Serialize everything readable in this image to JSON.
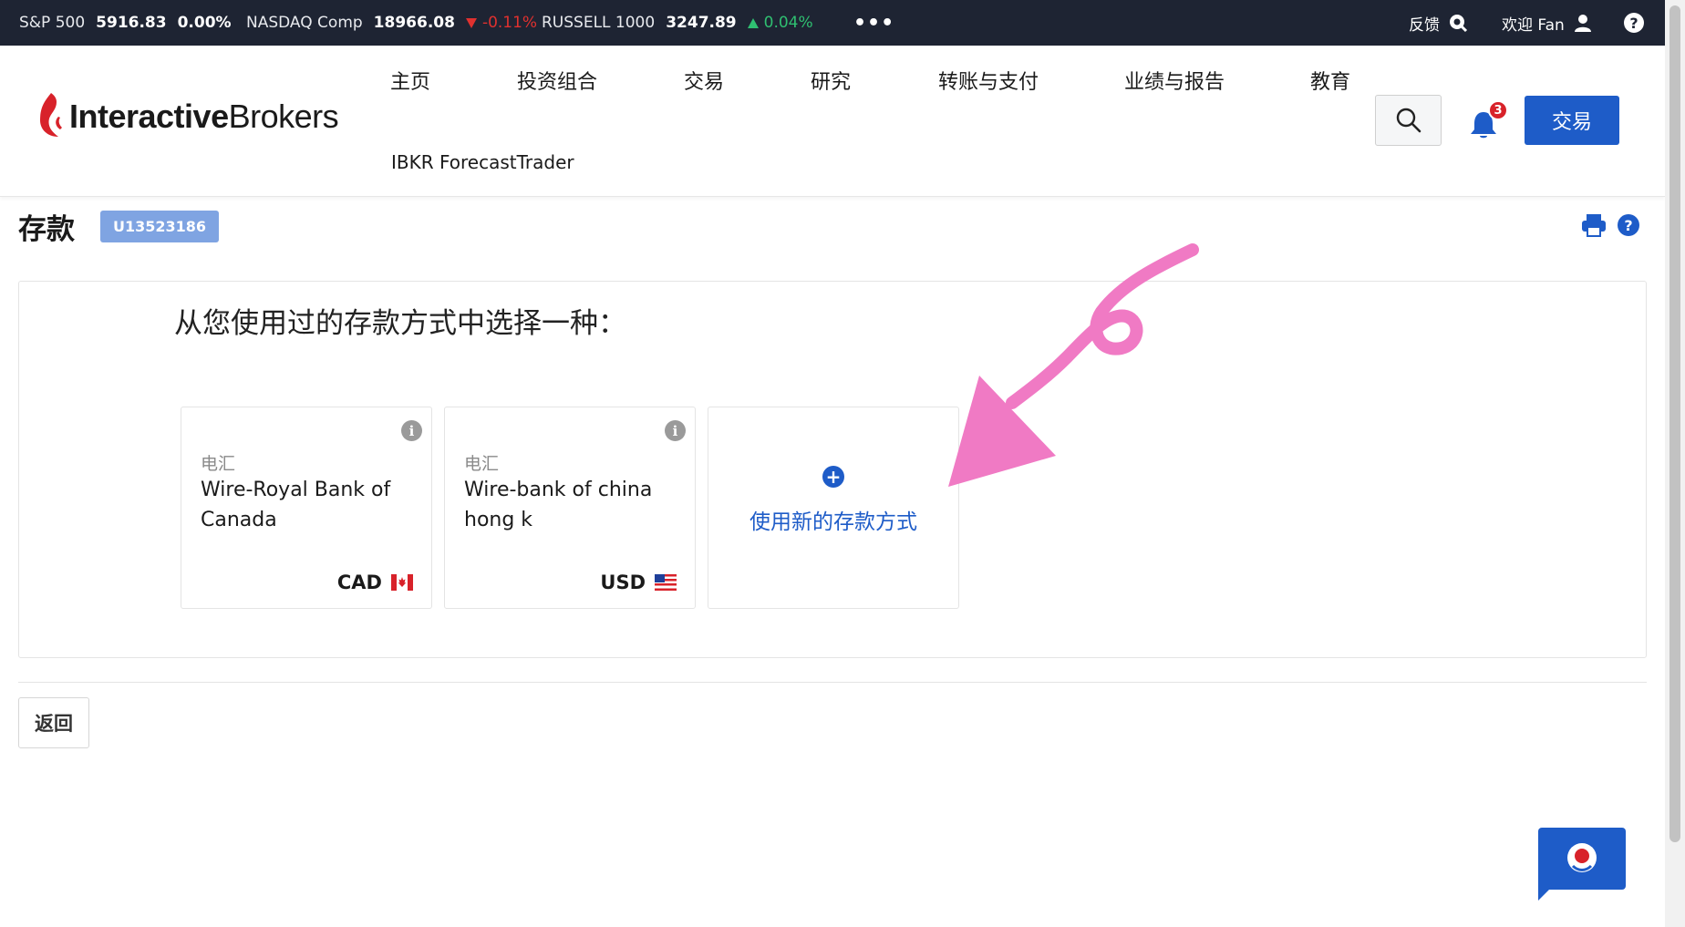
{
  "ticker": {
    "sp500": {
      "name": "S&P 500",
      "value": "5916.83",
      "change": "0.00%"
    },
    "nasdaq": {
      "name": "NASDAQ Comp",
      "value": "18966.08",
      "change": "-0.11%"
    },
    "russell": {
      "name": "RUSSELL 1000",
      "value": "3247.89",
      "change": "0.04%"
    },
    "more": "•••",
    "feedback": "反馈",
    "welcome": "欢迎 Fan",
    "help": "?"
  },
  "header": {
    "logo": {
      "interactive": "Interactive",
      "brokers": "Brokers"
    },
    "nav": [
      "主页",
      "投资组合",
      "交易",
      "研究",
      "转账与支付",
      "业绩与报告",
      "教育"
    ],
    "forecast": "IBKR ForecastTrader",
    "notification_count": "3",
    "trade_button": "交易"
  },
  "page": {
    "title": "存款",
    "account": "U13523186",
    "help": "?",
    "prompt": "从您使用过的存款方式中选择一种：",
    "methods": [
      {
        "type": "电汇",
        "name": "Wire-Royal Bank of Canada",
        "currency": "CAD",
        "flag": "canada-flag"
      },
      {
        "type": "电汇",
        "name": "Wire-bank of china hong k",
        "currency": "USD",
        "flag": "us-flag"
      }
    ],
    "add_method": "使用新的存款方式",
    "back": "返回"
  },
  "colors": {
    "ticker_bg": "#1e2433",
    "accent_blue": "#1e5cc8",
    "badge_blue": "#7fa4e2",
    "down_red": "#e0312f",
    "up_green": "#2fbf71",
    "annotation_pink": "#f07ac4"
  }
}
